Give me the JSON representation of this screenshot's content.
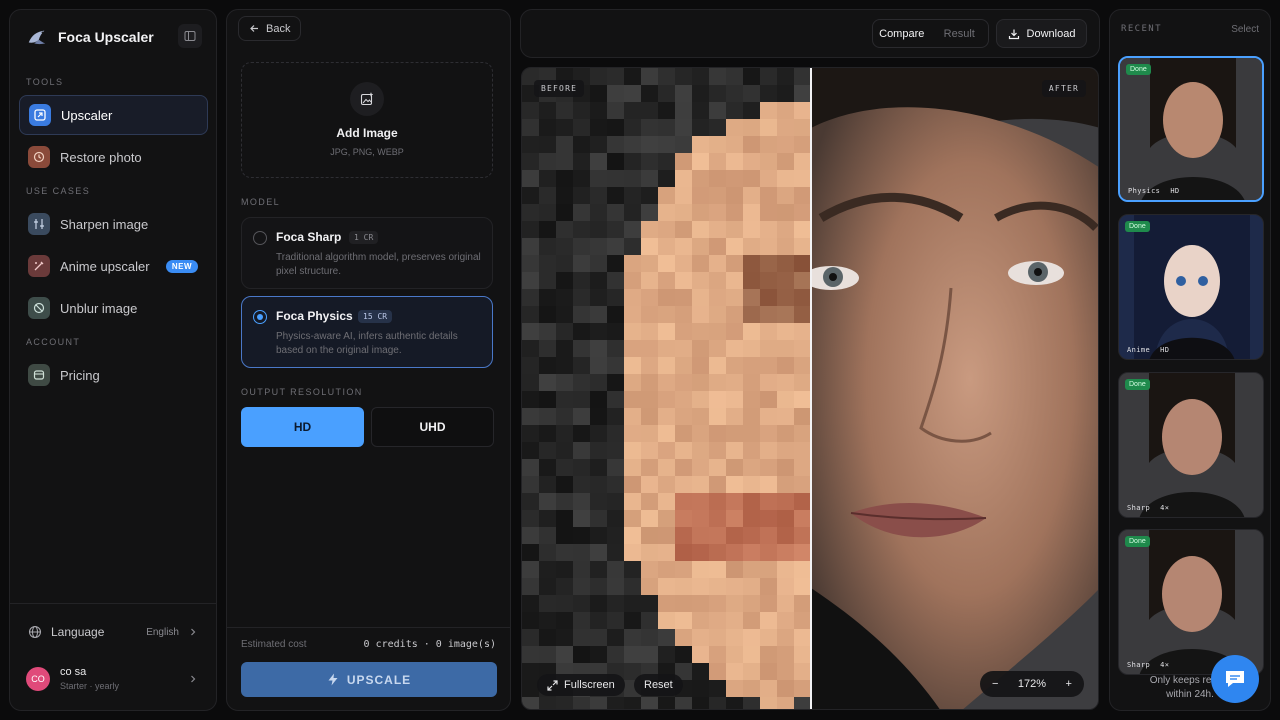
{
  "app": {
    "name": "Foca Upscaler"
  },
  "sidebar": {
    "sections": {
      "tools": "TOOLS",
      "use_cases": "USE CASES",
      "account": "ACCOUNT"
    },
    "items": [
      {
        "label": "Upscaler",
        "icon": "upscaler-icon",
        "active": true
      },
      {
        "label": "Restore photo",
        "icon": "restore-icon"
      },
      {
        "label": "Sharpen image",
        "icon": "sharpen-icon"
      },
      {
        "label": "Anime upscaler",
        "icon": "anime-icon",
        "badge": "NEW"
      },
      {
        "label": "Unblur image",
        "icon": "unblur-icon"
      },
      {
        "label": "Pricing",
        "icon": "pricing-icon"
      }
    ],
    "language": {
      "label": "Language",
      "value": "English"
    },
    "user": {
      "initials": "CO",
      "name": "co sa",
      "plan": "Starter · yearly"
    }
  },
  "controls": {
    "back_label": "Back",
    "dropzone": {
      "title": "Add Image",
      "formats": "JPG, PNG, WEBP"
    },
    "model_label": "MODEL",
    "models": [
      {
        "name": "Foca Sharp",
        "cost": "1 CR",
        "desc": "Traditional algorithm model, preserves original pixel structure.",
        "selected": false
      },
      {
        "name": "Foca Physics",
        "cost": "15 CR",
        "desc": "Physics-aware AI, infers authentic details based on the original image.",
        "selected": true
      }
    ],
    "resolution_label": "OUTPUT RESOLUTION",
    "resolutions": [
      "HD",
      "UHD"
    ],
    "selected_resolution": "HD",
    "cost_label": "Estimated cost",
    "cost_value": "0 credits · 0 image(s)",
    "upscale_label": "UPSCALE"
  },
  "viewer": {
    "view_modes": [
      "Compare",
      "Result"
    ],
    "active_view": "Compare",
    "download_label": "Download",
    "before_tag": "BEFORE",
    "after_tag": "AFTER",
    "fullscreen_label": "Fullscreen",
    "reset_label": "Reset",
    "zoom_minus": "−",
    "zoom_level": "172%",
    "zoom_plus": "+"
  },
  "recent": {
    "title": "RECENT",
    "select_label": "Select",
    "items": [
      {
        "status": "Done",
        "tags": [
          "Physics",
          "HD"
        ],
        "selected": true
      },
      {
        "status": "Done",
        "tags": [
          "Anime",
          "HD"
        ]
      },
      {
        "status": "Done",
        "tags": [
          "Sharp",
          "4×"
        ]
      },
      {
        "status": "Done",
        "tags": [
          "Sharp",
          "4×"
        ]
      }
    ],
    "note_line1": "Only keeps recent",
    "note_line2": "within 24h."
  },
  "colors": {
    "accent": "#4aa0ff",
    "panel": "#121213",
    "background": "#0b0b0c",
    "done": "#1f8a4c",
    "new_badge": "#3a8cf4",
    "upscale_button": "#3d6aa6"
  }
}
